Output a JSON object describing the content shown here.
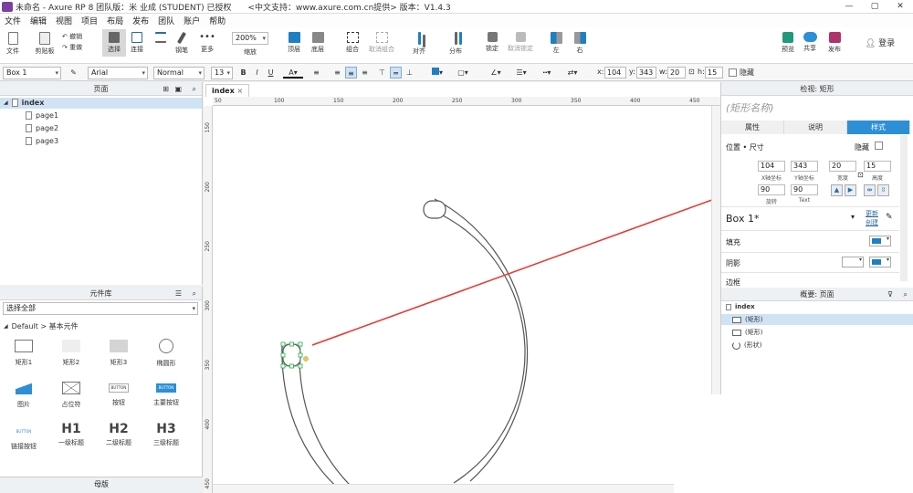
{
  "window": {
    "title": "未命名 - Axure RP 8 团队版：米 业成 (STUDENT) 已授权　　<中文支持：www.axure.com.cn提供> 版本：V1.4.3",
    "controls": {
      "minimize": "—",
      "maximize": "▢",
      "close": "✕"
    }
  },
  "menu": [
    "文件",
    "编辑",
    "视图",
    "项目",
    "布局",
    "发布",
    "团队",
    "账户",
    "帮助"
  ],
  "toolbar": {
    "file": "文件",
    "clipboard": "剪贴板",
    "undo": "撤销",
    "redo": "重做",
    "select": "选择",
    "connect": "连接",
    "pen": "钢笔",
    "more": "更多",
    "zoom_value": "200%",
    "zoom_label": "缩放",
    "top": "顶层",
    "bottom": "底层",
    "group": "组合",
    "ungroup": "取消组合",
    "align": "对齐",
    "distribute": "分布",
    "lock": "锁定",
    "unlock": "取消锁定",
    "left": "左",
    "right": "右",
    "preview": "预览",
    "share": "共享",
    "publish": "发布",
    "login": "登录"
  },
  "format": {
    "style": "Box 1",
    "font": "Arial",
    "weight": "Normal",
    "size": "13",
    "bold": "B",
    "italic": "I",
    "underline": "U",
    "x_label": "x:",
    "x": "104",
    "y_label": "y:",
    "y": "343",
    "w_label": "w:",
    "w": "20",
    "h_label": "h:",
    "h": "15",
    "hidden": "隐藏"
  },
  "pages": {
    "title": "页面",
    "root": "index",
    "children": [
      "page1",
      "page2",
      "page3"
    ]
  },
  "library": {
    "title": "元件库",
    "filter": "选择全部",
    "group": "Default > 基本元件",
    "items": [
      "矩形1",
      "矩形2",
      "矩形3",
      "椭圆形",
      "图片",
      "占位符",
      "按钮",
      "主要按钮",
      "链接按钮",
      "一级标题",
      "二级标题",
      "三级标题"
    ],
    "button_text": "BUTTON",
    "h1": "H1",
    "h2": "H2",
    "h3": "H3"
  },
  "masters": {
    "title": "母版"
  },
  "canvas": {
    "tab": "index",
    "ruler_h": [
      "50",
      "100",
      "150",
      "200",
      "250",
      "300",
      "350",
      "400",
      "450"
    ],
    "ruler_v": [
      "150",
      "200",
      "250",
      "300",
      "350",
      "400",
      "450"
    ],
    "arrow_color": "#e53935"
  },
  "inspector": {
    "title": "检视: 矩形",
    "name_placeholder": "(矩形名称)",
    "tabs": [
      "属性",
      "说明",
      "样式"
    ],
    "position_size": "位置 • 尺寸",
    "hidden": "隐藏",
    "x": "104",
    "y": "343",
    "w": "20",
    "h": "15",
    "x_label": "X轴坐标",
    "y_label": "Y轴坐标",
    "w_label": "宽度",
    "h_label": "高度",
    "rotate": "90",
    "text_rotate": "90",
    "rotate_label": "旋转",
    "text_label": "Text",
    "style_name": "Box 1*",
    "update": "更新",
    "create": "创建",
    "fill": "填充",
    "shadow": "阴影",
    "border": "边框",
    "fill_color": "#1e7fc4"
  },
  "outline": {
    "title": "概要: 页面",
    "root": "index",
    "items": [
      "(矩形)",
      "(矩形)",
      "(形状)"
    ]
  }
}
